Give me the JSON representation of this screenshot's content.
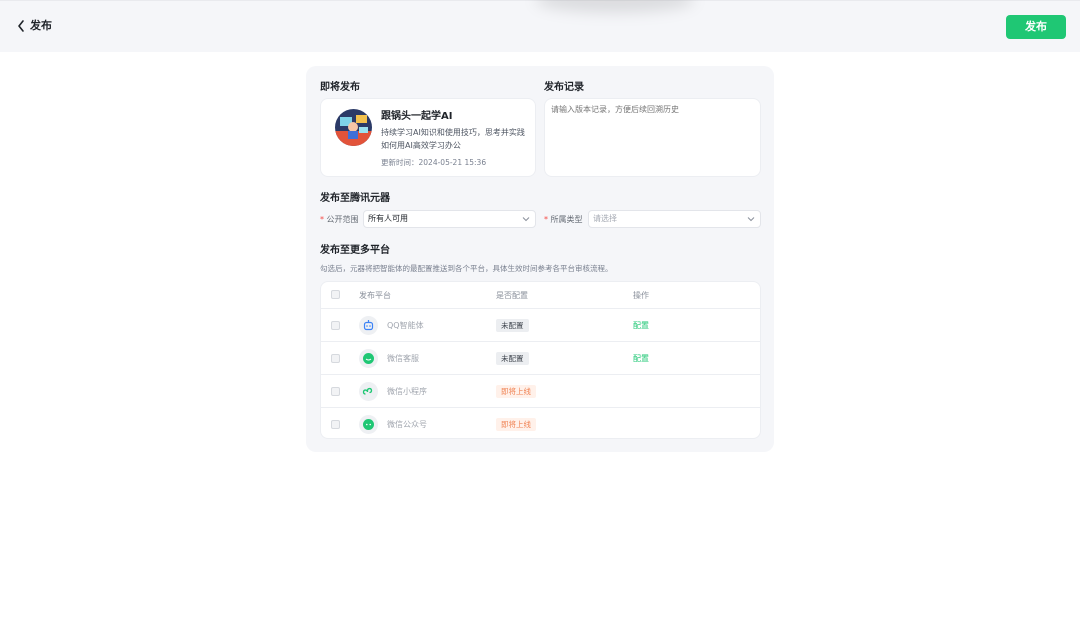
{
  "header": {
    "back_label": "发布",
    "publish_button": "发布",
    "accent": "#1fc774"
  },
  "upcoming": {
    "title": "即将发布",
    "agent_name": "跟锅头一起学AI",
    "agent_desc": "持续学习AI知识和使用技巧，思考并实践如何用AI高效学习办公",
    "updated_label": "更新时间：",
    "updated_time": "2024-05-21 15:36"
  },
  "record": {
    "title": "发布记录",
    "placeholder": "请输入版本记录，方便后续回溯历史"
  },
  "tencent": {
    "title": "发布至腾讯元器",
    "scope_label": "公开范围",
    "scope_value": "所有人可用",
    "type_label": "所属类型",
    "type_placeholder": "请选择"
  },
  "platforms": {
    "title": "发布至更多平台",
    "note": "勾选后，元器将把智能体的最配置推送到各个平台，具体生效时间参考各平台审核流程。",
    "headers": {
      "platform": "发布平台",
      "configured": "是否配置",
      "action": "操作"
    },
    "rows": [
      {
        "name": "QQ智能体",
        "status": "未配置",
        "status_kind": "gray",
        "action": "配置",
        "icon": "qq-bot-icon",
        "icon_color": "#3b82f6"
      },
      {
        "name": "微信客服",
        "status": "未配置",
        "status_kind": "gray",
        "action": "配置",
        "icon": "wechat-service-icon",
        "icon_color": "#1fc774"
      },
      {
        "name": "微信小程序",
        "status": "即将上线",
        "status_kind": "orange",
        "action": "",
        "icon": "mini-program-icon",
        "icon_color": "#1fc774"
      },
      {
        "name": "微信公众号",
        "status": "即将上线",
        "status_kind": "orange",
        "action": "",
        "icon": "official-account-icon",
        "icon_color": "#1fc774"
      }
    ]
  }
}
